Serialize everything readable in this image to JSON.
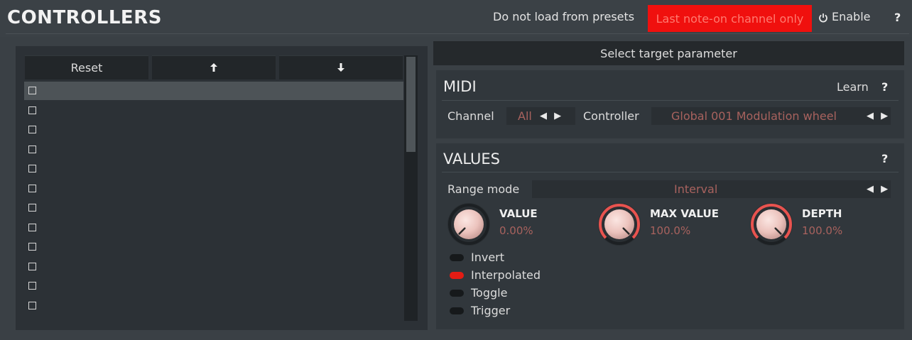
{
  "header": {
    "title": "CONTROLLERS",
    "no_presets_label": "Do not load from presets",
    "last_note_label": "Last note-on channel only",
    "enable_label": "Enable",
    "help_label": "?"
  },
  "controller_list": {
    "reset_label": "Reset",
    "up_label": "🡡",
    "down_label": "🡣",
    "selected_index": 0,
    "rows": [
      "",
      "",
      "",
      "",
      "",
      "",
      "",
      "",
      "",
      "",
      "",
      ""
    ]
  },
  "target": {
    "select_label": "Select target parameter"
  },
  "midi": {
    "title": "MIDI",
    "learn_label": "Learn",
    "help_label": "?",
    "channel_label": "Channel",
    "channel_value": "All",
    "controller_label": "Controller",
    "controller_value": "Global 001 Modulation wheel"
  },
  "values": {
    "title": "VALUES",
    "help_label": "?",
    "range_mode_label": "Range mode",
    "range_mode_value": "Interval",
    "knobs": [
      {
        "label": "VALUE",
        "value": "0.00%",
        "fraction": 0.0
      },
      {
        "label": "MAX VALUE",
        "value": "100.0%",
        "fraction": 1.0
      },
      {
        "label": "DEPTH",
        "value": "100.0%",
        "fraction": 1.0
      }
    ],
    "toggles": [
      {
        "label": "Invert",
        "on": false
      },
      {
        "label": "Interpolated",
        "on": true
      },
      {
        "label": "Toggle",
        "on": false
      },
      {
        "label": "Trigger",
        "on": false
      }
    ]
  },
  "colors": {
    "accent_red": "#f0100e",
    "value_text": "#a8625e",
    "knob_ring": "#e8534f"
  },
  "icons": {
    "enable": "power-icon",
    "arrow_pair": "left-right-arrows-icon"
  }
}
